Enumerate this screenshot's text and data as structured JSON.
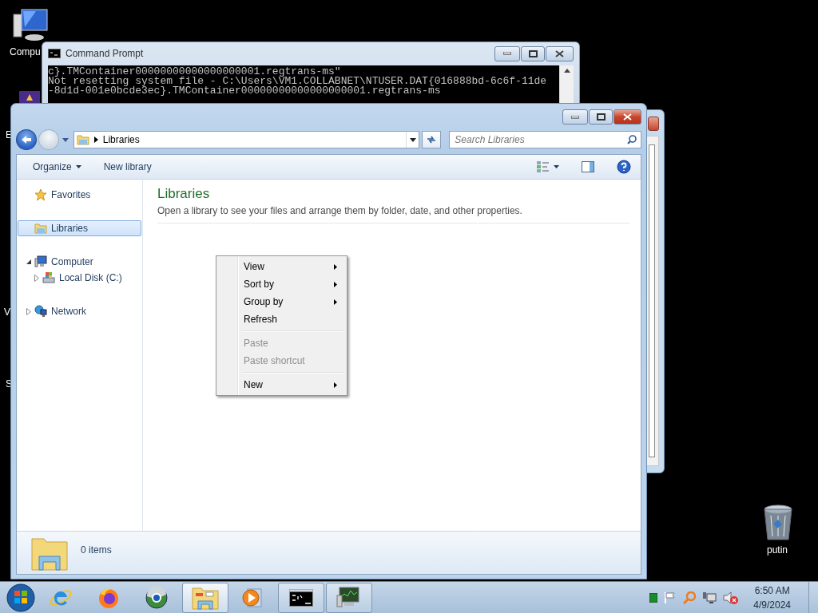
{
  "desktop_icons": [
    {
      "kind": "computer",
      "label": "Compu"
    },
    {
      "kind": "hidden",
      "label": "E"
    },
    {
      "kind": "hidden",
      "label": "V"
    },
    {
      "kind": "hidden",
      "label": "S"
    },
    {
      "kind": "recycle",
      "label": "putin"
    }
  ],
  "cmd_window": {
    "title": "Command Prompt",
    "lines": [
      "c}.TMContainer00000000000000000001.regtrans-ms\"",
      "Not resetting system file - C:\\Users\\VM1.COLLABNET\\NTUSER.DAT{016888bd-6c6f-11de",
      "-8d1d-001e0bcde3ec}.TMContainer00000000000000000001.regtrans-ms"
    ]
  },
  "explorer": {
    "address": "Libraries",
    "search": {
      "placeholder": "Search Libraries"
    },
    "toolbar": [
      {
        "label": "Organize",
        "dropdown": true
      },
      {
        "label": "New library",
        "dropdown": false
      }
    ],
    "nav": [
      {
        "kind": "favorites",
        "label": "Favorites",
        "selected": false
      },
      {
        "kind": "libraries",
        "label": "Libraries",
        "selected": true
      },
      {
        "kind": "computer",
        "label": "Computer",
        "selected": false,
        "expanded": true,
        "children": [
          {
            "kind": "disk",
            "label": "Local Disk (C:)",
            "selected": false,
            "expanded": false
          }
        ]
      },
      {
        "kind": "network",
        "label": "Network",
        "selected": false,
        "expanded": false
      }
    ],
    "heading": "Libraries",
    "subtitle": "Open a library to see your files and arrange them by folder, date, and other properties.",
    "status": "0 items"
  },
  "context_menu": {
    "groups": [
      [
        {
          "label": "View",
          "submenu": true,
          "disabled": false
        },
        {
          "label": "Sort by",
          "submenu": true,
          "disabled": false
        },
        {
          "label": "Group by",
          "submenu": true,
          "disabled": false
        },
        {
          "label": "Refresh",
          "submenu": false,
          "disabled": false
        }
      ],
      [
        {
          "label": "Paste",
          "submenu": false,
          "disabled": true
        },
        {
          "label": "Paste shortcut",
          "submenu": false,
          "disabled": true
        }
      ],
      [
        {
          "label": "New",
          "submenu": true,
          "disabled": false
        }
      ]
    ]
  },
  "taskbar": {
    "apps": [
      {
        "kind": "ie",
        "running": false,
        "selected": false
      },
      {
        "kind": "firefox",
        "running": false,
        "selected": false
      },
      {
        "kind": "globe",
        "running": false,
        "selected": false
      },
      {
        "kind": "explorer",
        "running": true,
        "selected": true
      },
      {
        "kind": "media",
        "running": false,
        "selected": false
      },
      {
        "kind": "cmd",
        "running": true,
        "selected": false
      },
      {
        "kind": "monitor",
        "running": true,
        "selected": false
      }
    ],
    "clock": {
      "time": "6:50 AM",
      "date": "4/9/2024"
    }
  }
}
